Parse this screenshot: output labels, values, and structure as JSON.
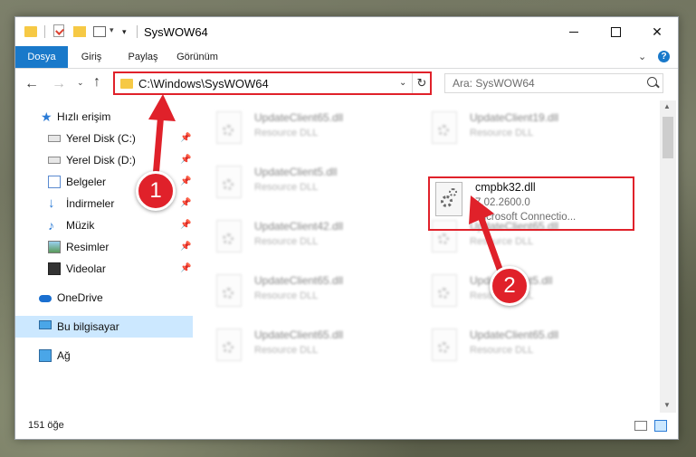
{
  "window": {
    "title": "SysWOW64",
    "qat_dropdown": "▾"
  },
  "ribbon": {
    "tabs": [
      "Dosya",
      "Giriş",
      "Paylaş",
      "Görünüm"
    ],
    "expand": "⌄",
    "help": "?"
  },
  "nav": {
    "back": "←",
    "forward": "→",
    "recent": "⌄",
    "up": "↑",
    "address": "C:\\Windows\\SysWOW64",
    "address_dropdown": "⌄",
    "refresh": "↻",
    "search_placeholder": "Ara: SysWOW64"
  },
  "sidebar": {
    "items": [
      {
        "label": "Hızlı erişim",
        "icon": "star-icon"
      },
      {
        "label": "Yerel Disk (C:)",
        "icon": "drive-icon",
        "pinned": true
      },
      {
        "label": "Yerel Disk (D:)",
        "icon": "drive-icon",
        "pinned": true
      },
      {
        "label": "Belgeler",
        "icon": "documents-icon",
        "pinned": true
      },
      {
        "label": "İndirmeler",
        "icon": "downloads-icon",
        "pinned": true
      },
      {
        "label": "Müzik",
        "icon": "music-icon",
        "pinned": true
      },
      {
        "label": "Resimler",
        "icon": "pictures-icon",
        "pinned": true
      },
      {
        "label": "Videolar",
        "icon": "videos-icon",
        "pinned": true
      },
      {
        "label": "OneDrive",
        "icon": "cloud-icon"
      },
      {
        "label": "Bu bilgisayar",
        "icon": "computer-icon",
        "selected": true
      },
      {
        "label": "Ağ",
        "icon": "network-icon"
      }
    ],
    "pin_glyph": "📌"
  },
  "files": {
    "left_column": [
      {
        "name": "UpdateClient65.dll",
        "desc": "Resource DLL"
      },
      {
        "name": "UpdateClient5.dll",
        "desc": "Resource DLL"
      },
      {
        "name": "UpdateClient42.dll",
        "desc": "Resource DLL"
      },
      {
        "name": "UpdateClient65.dll",
        "desc": "Resource DLL"
      },
      {
        "name": "UpdateClient65.dll",
        "desc": "Resource DLL"
      }
    ],
    "right_column": [
      {
        "name": "UpdateClient19.dll",
        "desc": "Resource DLL"
      },
      {
        "name": "UpdateClient65.dll",
        "desc": "Resource DLL"
      },
      {
        "name": "UpdateClient5.dll",
        "desc": "Resource DLL"
      },
      {
        "name": "UpdateClient65.dll",
        "desc": "Resource DLL"
      }
    ],
    "target": {
      "name": "cmpbk32.dll",
      "version": "7.02.2600.0",
      "description": "Microsoft Connectio..."
    }
  },
  "status": {
    "count": "151 öğe"
  },
  "annotations": {
    "badge1": "1",
    "badge2": "2",
    "color": "#e0212a"
  }
}
